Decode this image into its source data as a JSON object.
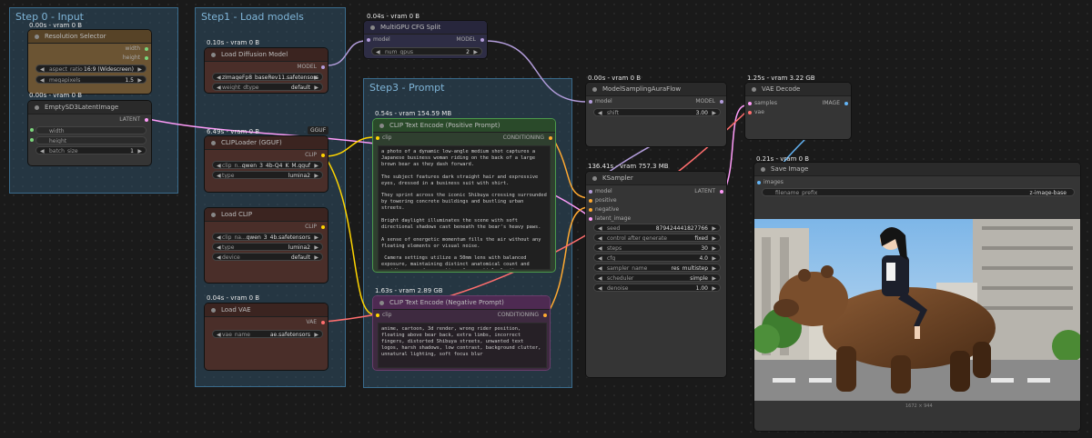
{
  "groups": {
    "step0": "Step 0 - Input",
    "step1": "Step1 - Load models",
    "step3": "Step3 - Prompt"
  },
  "resolution_selector": {
    "timing": "0.00s - vram 0 B",
    "title": "Resolution Selector",
    "out_width": "width",
    "out_height": "height",
    "aspect_label": "aspect_ratio",
    "aspect_value": "16:9 (Widescreen)",
    "mp_label": "megapixels",
    "mp_value": "1.5"
  },
  "empty_latent": {
    "timing": "0.00s - vram 0 B",
    "title": "EmptySD3LatentImage",
    "out_latent": "LATENT",
    "width_label": "width",
    "height_label": "height",
    "batch_label": "batch_size",
    "batch_value": "1"
  },
  "load_diffusion": {
    "timing": "0.10s - vram 0 B",
    "title": "Load Diffusion Model",
    "out_model": "MODEL",
    "unet_value": "zImageFp8_baseRev11.safetensors",
    "dtype_label": "weight_dtype",
    "dtype_value": "default"
  },
  "clip_gguf": {
    "timing": "6.49s - vram 0 B",
    "title": "CLIPLoader (GGUF)",
    "badge": "GGUF",
    "out_clip": "CLIP",
    "name_label": "clip_n…",
    "name_value": "qwen_3_4b-Q4_K_M.gguf",
    "type_label": "type",
    "type_value": "lumina2"
  },
  "load_clip": {
    "title": "Load CLIP",
    "out_clip": "CLIP",
    "name_label": "clip_na…",
    "name_value": "qwen_3_4b.safetensors",
    "type_label": "type",
    "type_value": "lumina2",
    "device_label": "device",
    "device_value": "default"
  },
  "load_vae": {
    "timing": "0.04s - vram 0 B",
    "title": "Load VAE",
    "out_vae": "VAE",
    "name_label": "vae_name",
    "name_value": "ae.safetensors"
  },
  "multigpu": {
    "timing": "0.04s - vram 0 B",
    "title": "MultiGPU CFG Split",
    "in_model": "model",
    "out_model": "MODEL",
    "gpus_label": "num_gpus",
    "gpus_value": "2"
  },
  "clip_pos": {
    "timing": "0.54s - vram 154.59 MB",
    "title": "CLIP Text Encode (Positive Prompt)",
    "in_clip": "clip",
    "out_cond": "CONDITIONING",
    "text": "a photo of a dynamic low-angle medium shot captures a Japanese business woman riding on the back of a large brown bear as they dash forward.\n\nThe subject features dark straight hair and expressive eyes, dressed in a business suit with shirt.\n\nThey sprint across the iconic Shibuya crossing surrounded by towering concrete buildings and bustling urban streets.\n\nBright daylight illuminates the scene with soft directional shadows cast beneath the bear's heavy paws.\n\nA sense of energetic momentum fills the air without any floating elements or visual noise.\n\n Camera settings utilize a 50mm lens with balanced exposure, maintaining distinct anatomical count and avoiding warped proportions for spatial clarity."
  },
  "clip_neg": {
    "timing": "1.63s - vram 2.89 GB",
    "title": "CLIP Text Encode (Negative Prompt)",
    "in_clip": "clip",
    "out_cond": "CONDITIONING",
    "text": "anime, cartoon, 3d render, wrong rider position, floating above bear back, extra limbs, incorrect fingers, distorted Shibuya streets, unwanted text logos, harsh shadows, low contrast, background clutter, unnatural lighting, soft focus blur"
  },
  "sampling_aura": {
    "timing": "0.00s - vram 0 B",
    "title": "ModelSamplingAuraFlow",
    "in_model": "model",
    "out_model": "MODEL",
    "shift_label": "shift",
    "shift_value": "3.00"
  },
  "ksampler": {
    "timing": "136.41s - vram 757.3 MB",
    "title": "KSampler",
    "in_model": "model",
    "in_positive": "positive",
    "in_negative": "negative",
    "in_latent": "latent_image",
    "out_latent": "LATENT",
    "widgets": [
      {
        "label": "seed",
        "value": "879424441827766"
      },
      {
        "label": "control after generate",
        "value": "fixed"
      },
      {
        "label": "steps",
        "value": "30"
      },
      {
        "label": "cfg",
        "value": "4.0"
      },
      {
        "label": "sampler_name",
        "value": "res_multistep"
      },
      {
        "label": "scheduler",
        "value": "simple"
      },
      {
        "label": "denoise",
        "value": "1.00"
      }
    ]
  },
  "vae_decode": {
    "timing": "1.25s - vram 3.22 GB",
    "title": "VAE Decode",
    "in_samples": "samples",
    "in_vae": "vae",
    "out_image": "IMAGE"
  },
  "save_image": {
    "timing": "0.21s - vram 0 B",
    "title": "Save Image",
    "in_images": "images",
    "prefix_label": "filename_prefix",
    "prefix_value": "z-image-base",
    "caption": "1672 × 944"
  },
  "colors": {
    "group_title": "#7fb5d8",
    "wire_model": "#b39ddb",
    "wire_clip": "#ffd500",
    "wire_cond": "#ffa931",
    "wire_latent": "#ff9cf9",
    "wire_vae": "#ff6e6e",
    "wire_image": "#64b5f6"
  },
  "icons": [
    "node-status-dot",
    "arrow-left-icon",
    "arrow-right-icon"
  ]
}
